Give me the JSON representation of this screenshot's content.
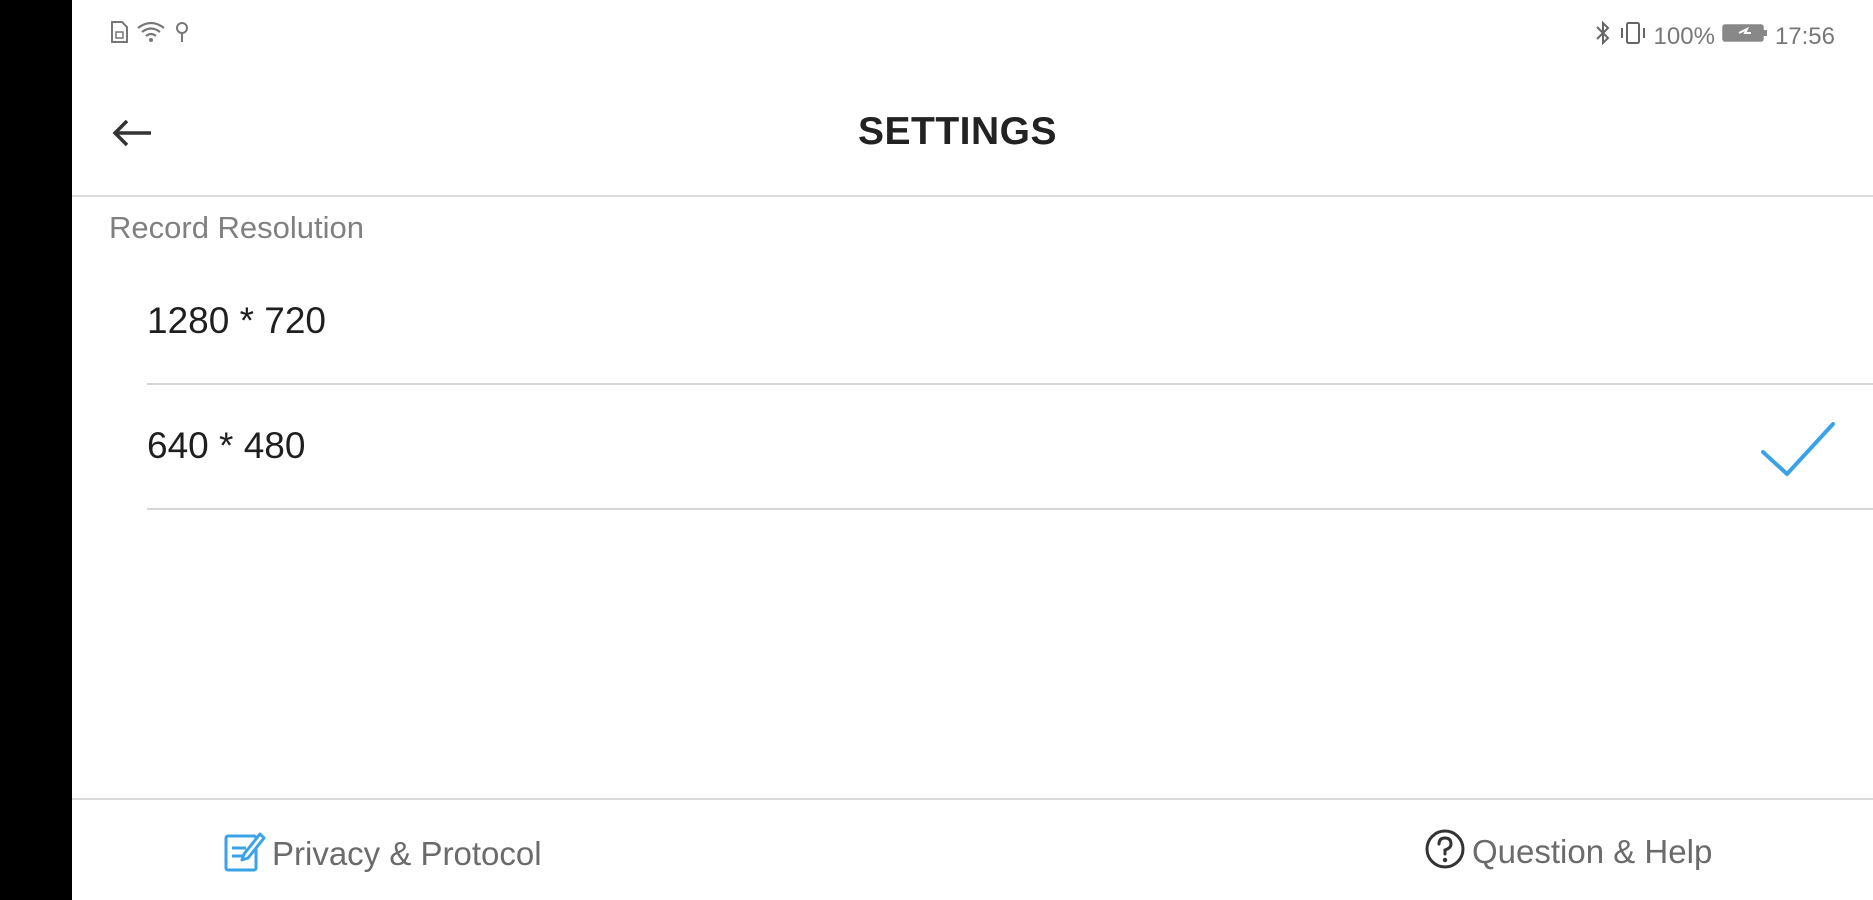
{
  "status_bar": {
    "battery": "100%",
    "time": "17:56",
    "icons_left": [
      "sim-icon",
      "wifi-icon",
      "location-icon"
    ],
    "icons_right": [
      "bluetooth-icon",
      "vibrate-icon",
      "battery-icon"
    ]
  },
  "header": {
    "title": "SETTINGS",
    "back_icon": "back-arrow-icon"
  },
  "record_resolution": {
    "label": "Record Resolution",
    "options": [
      {
        "label": "1280 * 720",
        "selected": false
      },
      {
        "label": "640 * 480",
        "selected": true
      }
    ]
  },
  "footer": {
    "privacy_label": "Privacy & Protocol",
    "help_label": "Question & Help"
  },
  "colors": {
    "accent": "#3aa3e8",
    "divider": "#d6d6d6",
    "text_primary": "#1f1f1f",
    "text_secondary": "#808080"
  }
}
